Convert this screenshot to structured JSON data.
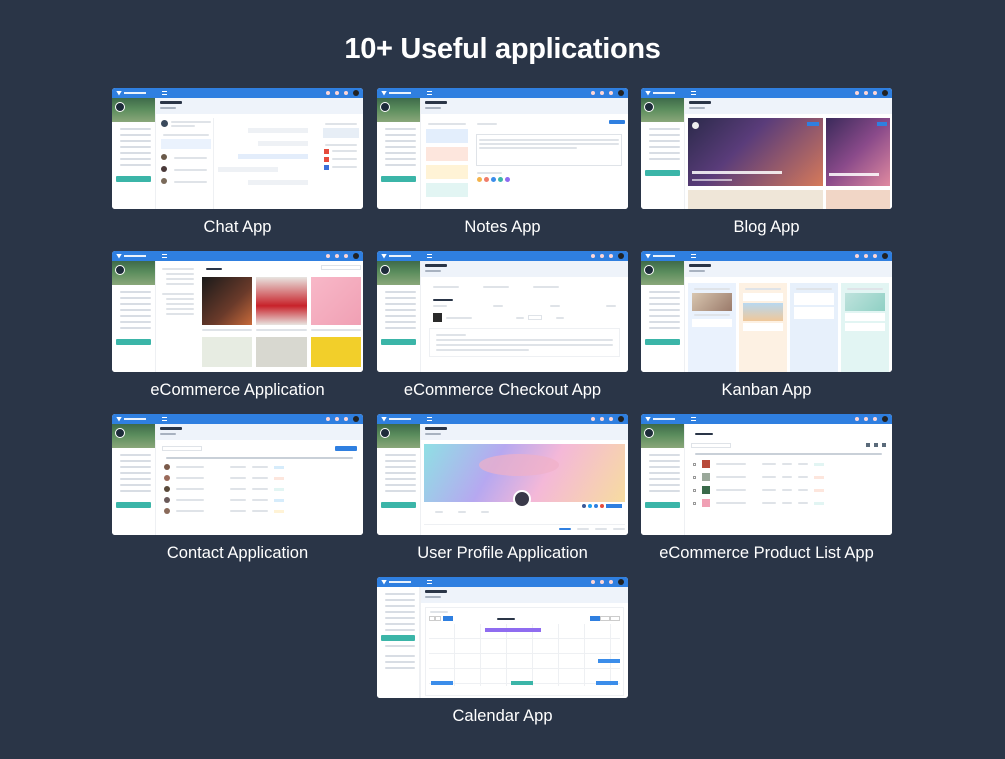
{
  "heading": "10+ Useful applications",
  "apps": [
    {
      "caption": "Chat App",
      "icon": "chat-icon"
    },
    {
      "caption": "Notes App",
      "icon": "notes-icon"
    },
    {
      "caption": "Blog App",
      "icon": "blog-icon"
    },
    {
      "caption": "eCommerce Application",
      "icon": "shop-icon"
    },
    {
      "caption": "eCommerce Checkout App",
      "icon": "cart-icon"
    },
    {
      "caption": "Kanban App",
      "icon": "kanban-icon"
    },
    {
      "caption": "Contact Application",
      "icon": "contacts-icon"
    },
    {
      "caption": "User Profile Application",
      "icon": "user-icon"
    },
    {
      "caption": "eCommerce Product List App",
      "icon": "list-icon"
    },
    {
      "caption": "Calendar App",
      "icon": "calendar-icon"
    }
  ],
  "colors": {
    "background": "#2a3547",
    "topbar": "#2f7fe0",
    "accent": "#3bb5a8",
    "text": "#ffffff"
  }
}
